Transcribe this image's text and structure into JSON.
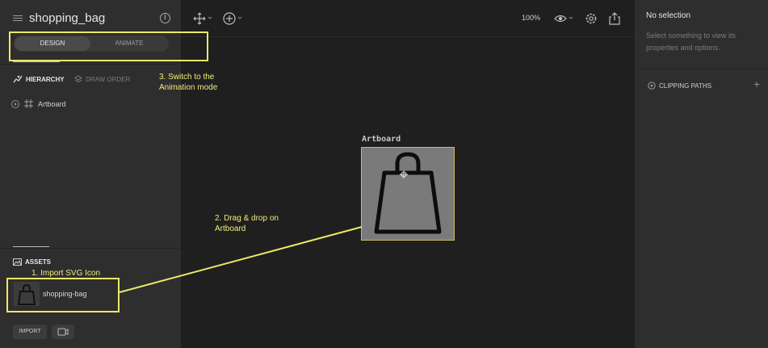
{
  "app": {
    "file_title": "shopping_bag",
    "info_icon": "info-icon",
    "menu_icon": "hamburger-menu-icon"
  },
  "mode": {
    "design_label": "DESIGN",
    "animate_label": "ANIMATE",
    "active": "DESIGN"
  },
  "tabs": {
    "hierarchy_label": "HIERARCHY",
    "draw_order_label": "DRAW ORDER"
  },
  "hierarchy": {
    "items": [
      {
        "label": "Artboard",
        "icon": "frame-icon"
      }
    ]
  },
  "assets": {
    "title": "ASSETS",
    "items": [
      {
        "label": "shopping-bag",
        "icon": "shopping-bag-icon"
      }
    ],
    "import_label": "IMPORT"
  },
  "toolbar": {
    "zoom": "100%",
    "tools": [
      "move-tool-icon",
      "add-tool-icon",
      "eye-icon",
      "settings-icon",
      "export-icon"
    ]
  },
  "inspector": {
    "title": "No selection",
    "description": "Select something to view its properties and options.",
    "clipping_label": "CLIPPING PATHS"
  },
  "canvas": {
    "artboard_label": "Artboard"
  },
  "annotations": {
    "step1": "1. Import SVG Icon",
    "step2_line1": "2. Drag & drop on",
    "step2_line2": "Artboard",
    "step3_line1": "3. Switch to the",
    "step3_line2": "Animation mode",
    "color": "#ece86a"
  }
}
